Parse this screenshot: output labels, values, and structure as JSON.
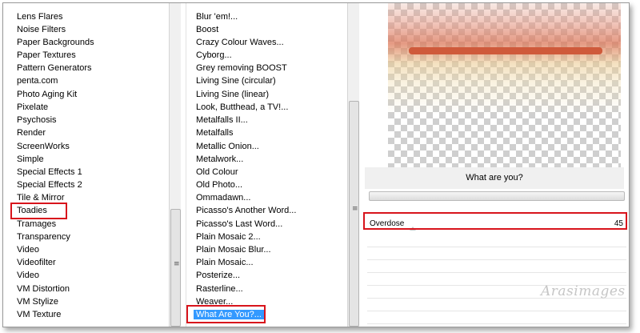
{
  "categories": {
    "items": [
      "Lens Flares",
      "Noise Filters",
      "Paper Backgrounds",
      "Paper Textures",
      "Pattern Generators",
      "penta.com",
      "Photo Aging Kit",
      "Pixelate",
      "Psychosis",
      "Render",
      "ScreenWorks",
      "Simple",
      "Special Effects 1",
      "Special Effects 2",
      "Tile & Mirror",
      "Toadies",
      "Tramages",
      "Transparency",
      "Video",
      "Videofilter",
      "Video",
      "VM Distortion",
      "VM Stylize",
      "VM Texture"
    ],
    "selected": "Toadies"
  },
  "filters": {
    "items": [
      "Blur 'em!...",
      "Boost",
      "Crazy Colour Waves...",
      "Cyborg...",
      "Grey removing BOOST",
      "Living Sine (circular)",
      "Living Sine (linear)",
      "Look, Butthead, a TV!...",
      "Metalfalls II...",
      "Metalfalls",
      "Metallic Onion...",
      "Metalwork...",
      "Old Colour",
      "Old Photo...",
      "Ommadawn...",
      "Picasso's Another Word...",
      "Picasso's Last Word...",
      "Plain Mosaic 2...",
      "Plain Mosaic Blur...",
      "Plain Mosaic...",
      "Posterize...",
      "Rasterline...",
      "Weaver...",
      "What Are You?..."
    ],
    "selected": "What Are You?..."
  },
  "panel": {
    "filter_title": "What are you?",
    "param_label": "Overdose",
    "param_value": "45"
  },
  "watermark": "Arasimages",
  "colors": {
    "highlight": "#3399ff",
    "annotation": "#d8141c",
    "preview_bar": "#cf5a3b"
  }
}
